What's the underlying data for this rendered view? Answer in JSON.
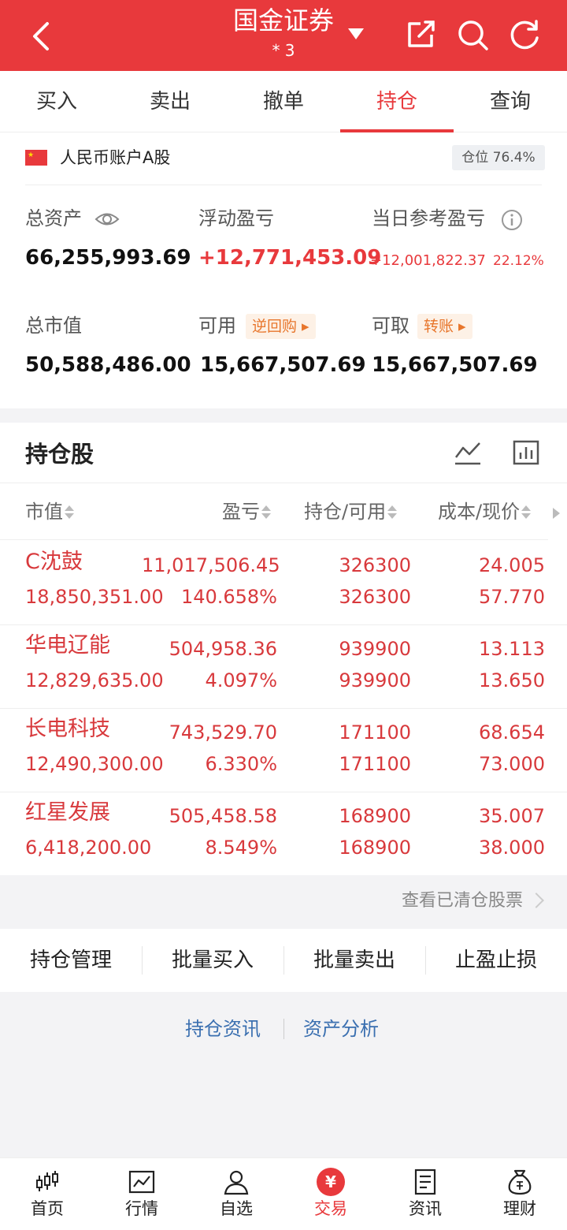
{
  "header": {
    "title": "国金证券",
    "account_masked": "*   3"
  },
  "tabs": [
    {
      "label": "买入"
    },
    {
      "label": "卖出"
    },
    {
      "label": "撤单"
    },
    {
      "label": "持仓",
      "active": true
    },
    {
      "label": "查询"
    }
  ],
  "account": {
    "name": "人民币账户A股",
    "position_badge": "仓位 76.4%",
    "total_assets_label": "总资产",
    "total_assets": "66,255,993.69",
    "floating_pl_label": "浮动盈亏",
    "floating_pl": "+12,771,453.09",
    "daily_pl_label": "当日参考盈亏",
    "daily_pl": "+12,001,822.37",
    "daily_pl_pct": "22.12%",
    "market_value_label": "总市值",
    "market_value": "50,588,486.00",
    "available_label": "可用",
    "reverse_repo": "逆回购",
    "available": "15,667,507.69",
    "withdrawable_label": "可取",
    "transfer": "转账",
    "withdrawable": "15,667,507.69"
  },
  "holdings": {
    "title": "持仓股",
    "columns": [
      "市值",
      "盈亏",
      "持仓/可用",
      "成本/现价"
    ],
    "rows": [
      {
        "name": "C沈鼓",
        "market_value": "18,850,351.00",
        "pl": "11,017,506.45",
        "pl_pct": "140.658%",
        "position": "326300",
        "available": "326300",
        "cost": "24.005",
        "price": "57.770"
      },
      {
        "name": "华电辽能",
        "market_value": "12,829,635.00",
        "pl": "504,958.36",
        "pl_pct": "4.097%",
        "position": "939900",
        "available": "939900",
        "cost": "13.113",
        "price": "13.650"
      },
      {
        "name": "长电科技",
        "market_value": "12,490,300.00",
        "pl": "743,529.70",
        "pl_pct": "6.330%",
        "position": "171100",
        "available": "171100",
        "cost": "68.654",
        "price": "73.000"
      },
      {
        "name": "红星发展",
        "market_value": "6,418,200.00",
        "pl": "505,458.58",
        "pl_pct": "8.549%",
        "position": "168900",
        "available": "168900",
        "cost": "35.007",
        "price": "38.000"
      }
    ],
    "view_cleared": "查看已清仓股票"
  },
  "actions": [
    "持仓管理",
    "批量买入",
    "批量卖出",
    "止盈止损"
  ],
  "links": [
    "持仓资讯",
    "资产分析"
  ],
  "nav": [
    {
      "label": "首页",
      "icon": "candlestick-icon"
    },
    {
      "label": "行情",
      "icon": "chart-icon"
    },
    {
      "label": "自选",
      "icon": "user-icon"
    },
    {
      "label": "交易",
      "icon": "yuan-icon",
      "active": true,
      "glyph": "¥"
    },
    {
      "label": "资讯",
      "icon": "document-icon"
    },
    {
      "label": "理财",
      "icon": "money-bag-icon"
    }
  ],
  "colors": {
    "brand_red": "#e8393c",
    "gain_red": "#d8393c",
    "link_blue": "#3a6fb0"
  }
}
